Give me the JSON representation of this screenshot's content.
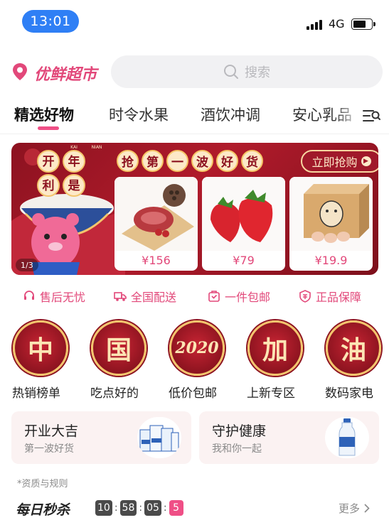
{
  "status_bar": {
    "time": "13:01",
    "network": "4G",
    "battery_percent": 70
  },
  "header": {
    "brand": "优鲜超市",
    "search_placeholder": "搜索"
  },
  "tabs": [
    {
      "label": "精选好物",
      "active": true
    },
    {
      "label": "时令水果",
      "active": false
    },
    {
      "label": "酒饮冲调",
      "active": false
    },
    {
      "label": "安心乳品",
      "active": false
    }
  ],
  "banner": {
    "title_chars": [
      "抢",
      "第",
      "一",
      "波",
      "好",
      "货"
    ],
    "art_chars": [
      "开",
      "年",
      "利",
      "是"
    ],
    "art_text": [
      "KAI",
      "NIAN"
    ],
    "buy_label": "立即抢购",
    "pager": "1/3",
    "products": [
      {
        "name": "beef-with-lotus-root",
        "price": "¥156"
      },
      {
        "name": "strawberries",
        "price": "¥79"
      },
      {
        "name": "boxed-eggs",
        "price": "¥19.9"
      }
    ]
  },
  "guarantees": [
    {
      "label": "售后无忧",
      "icon": "headset-icon"
    },
    {
      "label": "全国配送",
      "icon": "truck-icon"
    },
    {
      "label": "一件包邮",
      "icon": "package-icon"
    },
    {
      "label": "正品保障",
      "icon": "shield-icon"
    }
  ],
  "categories": [
    {
      "glyph": "中",
      "label": "热销榜单"
    },
    {
      "glyph": "国",
      "label": "吃点好的"
    },
    {
      "glyph": "2020",
      "label": "低价包邮"
    },
    {
      "glyph": "加",
      "label": "上新专区"
    },
    {
      "glyph": "油",
      "label": "数码家电"
    }
  ],
  "promos": [
    {
      "title": "开业大吉",
      "subtitle": "第一波好货"
    },
    {
      "title": "守护健康",
      "subtitle": "我和你一起"
    }
  ],
  "rules_link": "*资质与规则",
  "flash_sale": {
    "title": "每日秒杀",
    "countdown": [
      "10",
      "58",
      "05",
      "5"
    ],
    "more_label": "更多"
  },
  "colors": {
    "accent": "#e2487a",
    "underline": "#ef4f86",
    "banner_red": "#a0192a",
    "gold": "#f3c56d",
    "time_pill": "#2f7ff5"
  }
}
